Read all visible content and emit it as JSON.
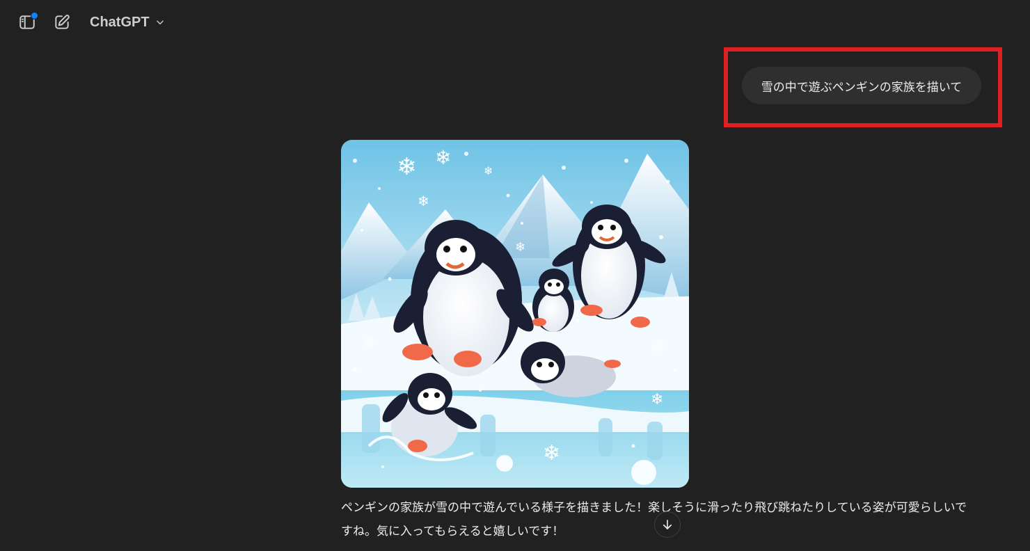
{
  "header": {
    "model_name": "ChatGPT",
    "sidebar_icon": "sidebar-toggle-icon",
    "new_chat_icon": "edit-icon",
    "dropdown_icon": "chevron-down-icon",
    "notification_color": "#0b84ff"
  },
  "conversation": {
    "user_message": "雪の中で遊ぶペンギンの家族を描いて",
    "assistant_image": "penguin family playing in the snow",
    "assistant_message": "ペンギンの家族が雪の中で遊んでいる様子を描きました！楽しそうに滑ったり飛び跳ねたりしている姿が可愛らしいですね。気に入ってもらえると嬉しいです！"
  },
  "scroll_button_icon": "arrow-down-icon",
  "colors": {
    "background": "#212121",
    "user_bubble": "#2f2f2f",
    "highlight": "#e01f23"
  }
}
